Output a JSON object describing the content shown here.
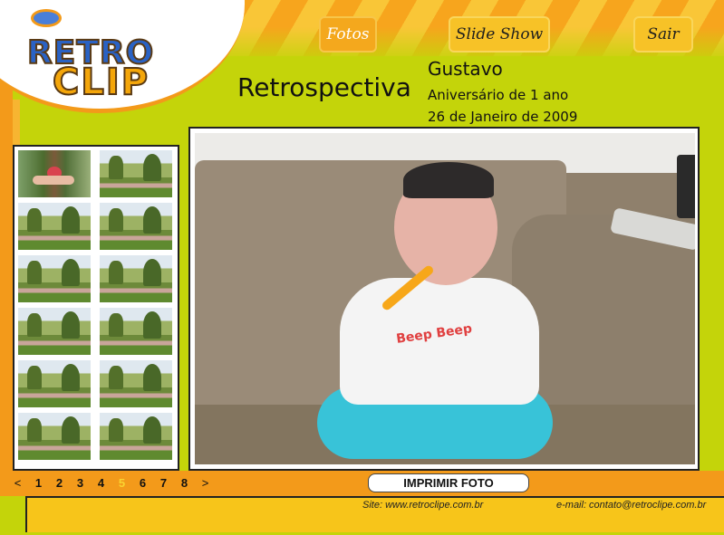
{
  "nav": {
    "fotos": "Fotos",
    "slideshow": "Slide Show",
    "sair": "Sair"
  },
  "logo": {
    "line1": "RETRO",
    "line2": "CLIP"
  },
  "header": {
    "title": "Retrospectiva",
    "name": "Gustavo",
    "event": "Aniversário de  1 ano",
    "date": "26 de Janeiro de 2009"
  },
  "pager": {
    "prev": "<",
    "pages": [
      "1",
      "2",
      "3",
      "4",
      "5",
      "6",
      "7",
      "8"
    ],
    "current": "5",
    "next": ">"
  },
  "print_button": "IMPRIMIR FOTO",
  "photo_text": "Beep Beep",
  "footer": {
    "site": "Site: www.retroclipe.com.br",
    "email": "e-mail: contato@retroclipe.com.br"
  },
  "colors": {
    "lime": "#c4d40a",
    "orange": "#f39a1a",
    "yellow": "#f7c51a",
    "active_page": "#f9d330"
  },
  "icons": [
    "logo-disc-icon"
  ]
}
